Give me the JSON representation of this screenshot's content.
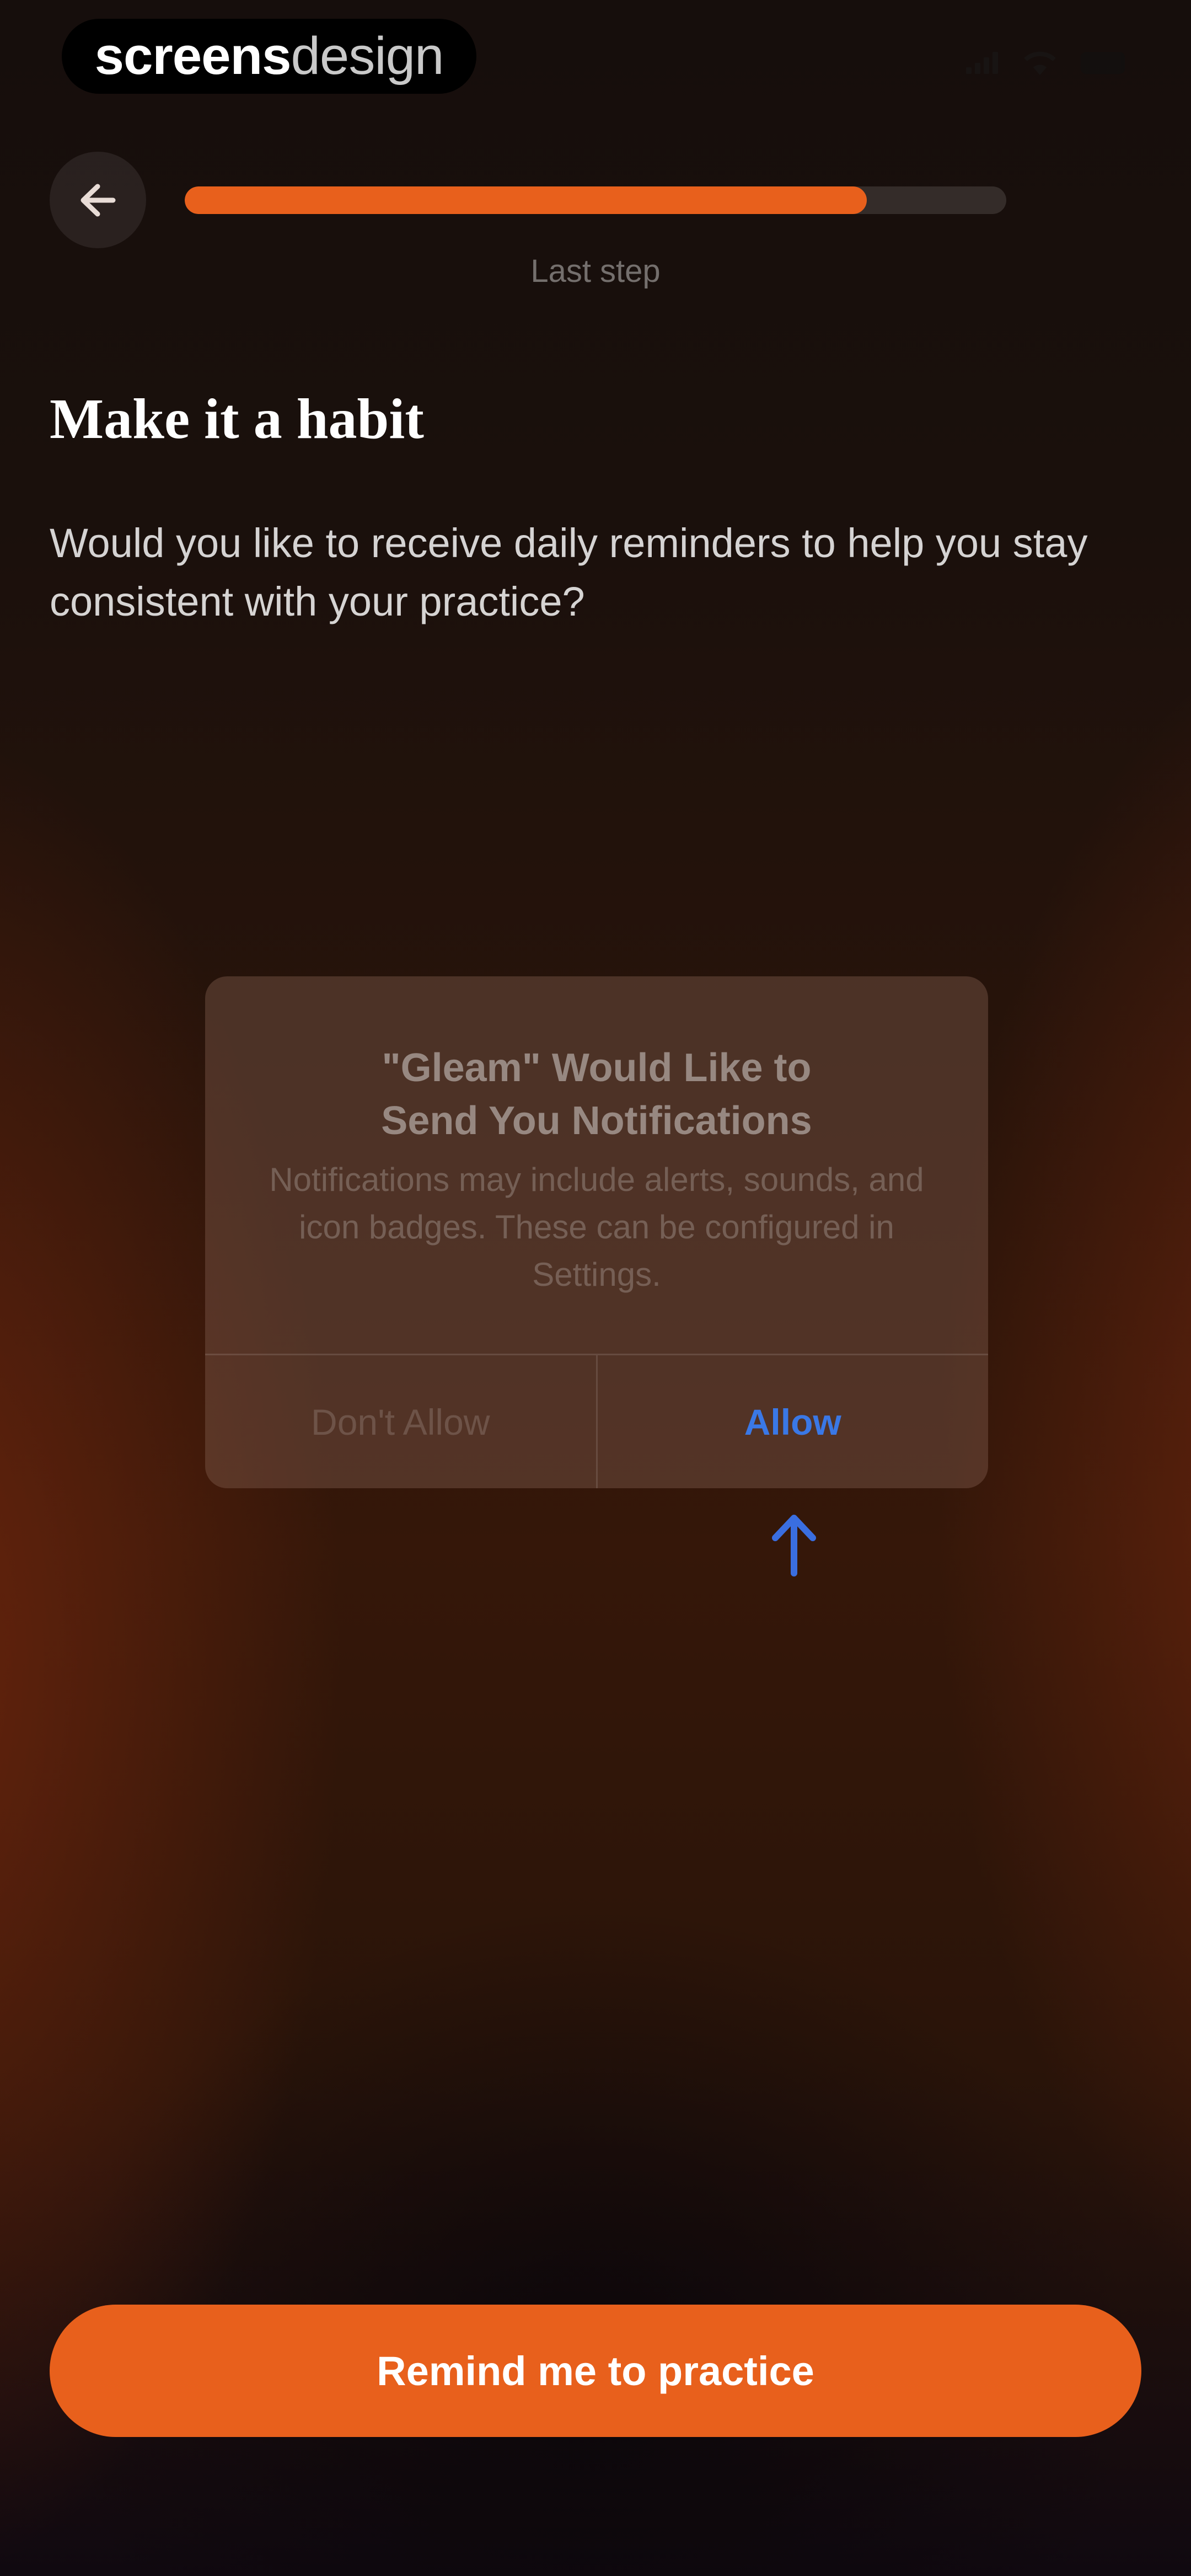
{
  "watermark": {
    "bold": "screens",
    "light": "design"
  },
  "header": {
    "step_label": "Last step",
    "progress_percent": 83
  },
  "content": {
    "title": "Make it a habit",
    "subtitle": "Would you like to receive daily reminders to help you stay consistent with your practice?"
  },
  "alert": {
    "title_line1": "\"Gleam\" Would Like to",
    "title_line2": "Send You Notifications",
    "message": "Notifications may include alerts, sounds, and icon badges. These can be configured in Settings.",
    "deny_label": "Don't Allow",
    "allow_label": "Allow"
  },
  "cta": {
    "label": "Remind me to practice"
  },
  "colors": {
    "accent": "#e8601c",
    "allow_blue": "#3a78e6"
  },
  "icons": {
    "back": "arrow-left-icon",
    "pointer": "arrow-up-icon"
  }
}
